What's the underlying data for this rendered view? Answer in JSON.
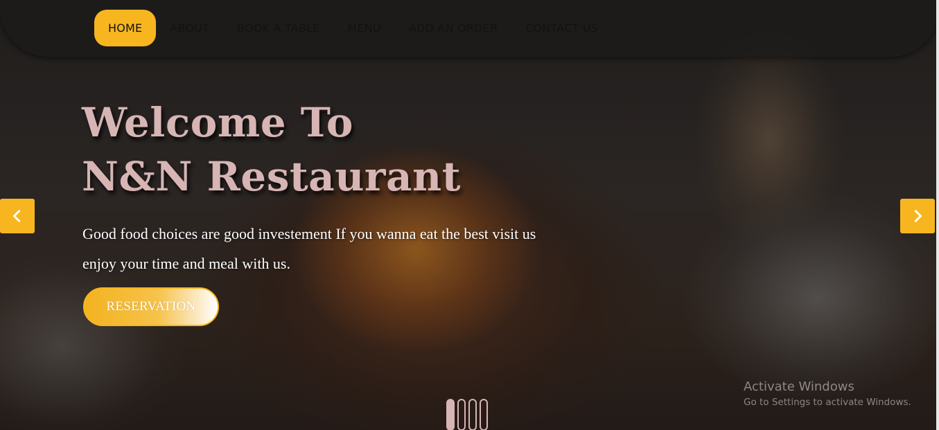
{
  "nav": {
    "items": [
      {
        "label": "HOME",
        "active": true
      },
      {
        "label": "ABOUT",
        "active": false
      },
      {
        "label": "BOOK A TABLE",
        "active": false
      },
      {
        "label": "MENU",
        "active": false
      },
      {
        "label": "ADD AN ORDER",
        "active": false
      },
      {
        "label": "CONTACT US",
        "active": false
      }
    ]
  },
  "hero": {
    "title_line1": "Welcome To",
    "title_line2": "N&N Restaurant",
    "desc_line1": "Good food choices are good investement If you wanna eat the best visit us",
    "desc_line2": "enjoy your time and meal with us.",
    "button_label": "RESERVATION"
  },
  "carousel": {
    "prev_icon": "chevron-left-icon",
    "next_icon": "chevron-right-icon",
    "slides": 4,
    "active_slide": 1
  },
  "watermark": {
    "title": "Activate Windows",
    "subtitle": "Go to Settings to activate Windows."
  },
  "colors": {
    "accent": "#f7b61f",
    "title_text": "#d7b5b5",
    "nav_text": "#121212"
  }
}
